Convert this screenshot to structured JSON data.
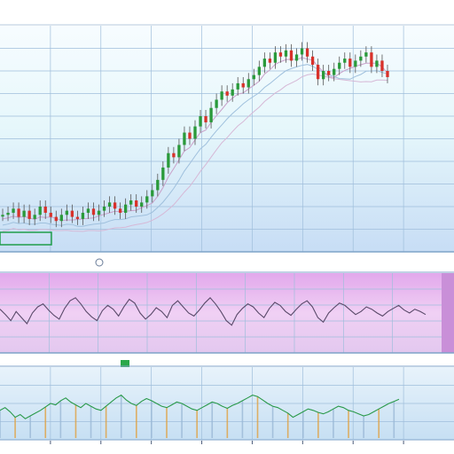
{
  "window": {
    "title": "",
    "colors": {
      "background": "#ffffff",
      "price_panel_top": "#f4fbff",
      "price_panel_bottom": "#c9e0f6",
      "oscillator_panel": "#e8b9f0",
      "volume_panel": "#cfe5f6",
      "grid": "#9fbedb",
      "candle_up": "#2a9a3a",
      "candle_down": "#d8312a",
      "oscillator_line": "#5a4a6a",
      "badge_green": "#1f9d4a"
    }
  },
  "chart_data": [
    {
      "type": "line",
      "x": [
        0,
        1,
        2,
        3,
        4,
        5,
        6,
        7,
        8,
        9,
        10,
        11,
        12,
        13,
        14,
        15,
        16,
        17,
        18,
        19,
        20,
        21,
        22,
        23,
        24,
        25,
        26,
        27,
        28,
        29,
        30,
        31,
        32,
        33,
        34,
        35,
        36,
        37,
        38,
        39,
        40,
        41,
        42,
        43,
        44,
        45,
        46,
        47,
        48,
        49,
        50,
        51,
        52,
        53,
        54,
        55,
        56,
        57,
        58,
        59,
        60,
        61,
        62,
        63,
        64,
        65,
        66,
        67,
        68,
        69,
        70,
        71,
        72
      ],
      "series": [
        {
          "values": [
            18,
            19,
            21,
            17,
            20,
            16,
            18,
            22,
            19,
            17,
            15,
            18,
            20,
            17,
            16,
            19,
            21,
            18,
            20,
            22,
            24,
            21,
            19,
            23,
            25,
            22,
            24,
            27,
            30,
            35,
            41,
            48,
            46,
            52,
            58,
            55,
            61,
            66,
            63,
            70,
            74,
            78,
            76,
            79,
            82,
            80,
            84,
            86,
            90,
            94,
            92,
            97,
            95,
            98,
            93,
            96,
            99,
            95,
            91,
            84,
            88,
            86,
            89,
            92,
            94,
            90,
            93,
            95,
            97,
            90,
            93,
            88,
            85
          ]
        }
      ],
      "ylim": [
        0,
        110
      ],
      "grid": true
    },
    {
      "type": "line",
      "x": [
        0,
        1,
        2,
        3,
        4,
        5,
        6,
        7,
        8,
        9,
        10,
        11,
        12,
        13,
        14,
        15,
        16,
        17,
        18,
        19,
        20,
        21,
        22,
        23,
        24,
        25,
        26,
        27,
        28,
        29,
        30,
        31,
        32,
        33,
        34,
        35,
        36,
        37,
        38,
        39,
        40,
        41,
        42,
        43,
        44,
        45,
        46,
        47,
        48,
        49,
        50,
        51,
        52,
        53,
        54,
        55,
        56,
        57,
        58,
        59,
        60,
        61,
        62,
        63,
        64,
        65,
        66,
        67,
        68,
        69,
        70,
        71,
        72,
        73,
        74,
        75,
        76,
        77,
        78,
        79
      ],
      "series": [
        {
          "values": [
            55,
            48,
            40,
            52,
            44,
            36,
            50,
            58,
            62,
            54,
            47,
            42,
            56,
            66,
            70,
            62,
            52,
            45,
            40,
            53,
            60,
            55,
            46,
            58,
            68,
            63,
            50,
            42,
            48,
            57,
            52,
            44,
            60,
            66,
            58,
            50,
            46,
            54,
            63,
            70,
            62,
            52,
            40,
            34,
            48,
            56,
            62,
            58,
            50,
            44,
            56,
            64,
            60,
            52,
            47,
            55,
            62,
            66,
            58,
            44,
            38,
            50,
            57,
            63,
            60,
            54,
            48,
            52,
            58,
            55,
            50,
            46,
            52,
            56,
            60,
            54,
            50,
            55,
            52,
            48
          ]
        }
      ],
      "ylim": [
        0,
        100
      ],
      "grid": true
    },
    {
      "type": "line",
      "x": [
        0,
        1,
        2,
        3,
        4,
        5,
        6,
        7,
        8,
        9,
        10,
        11,
        12,
        13,
        14,
        15,
        16,
        17,
        18,
        19,
        20,
        21,
        22,
        23,
        24,
        25,
        26,
        27,
        28,
        29,
        30,
        31,
        32,
        33,
        34,
        35,
        36,
        37,
        38,
        39,
        40,
        41,
        42,
        43,
        44,
        45,
        46,
        47,
        48,
        49,
        50,
        51,
        52,
        53,
        54,
        55,
        56,
        57,
        58,
        59,
        60,
        61,
        62,
        63,
        64,
        65,
        66,
        67,
        68,
        69,
        70,
        71,
        72,
        73,
        74,
        75,
        76,
        77,
        78,
        79
      ],
      "series": [
        {
          "values": [
            40,
            44,
            38,
            30,
            34,
            28,
            32,
            36,
            40,
            45,
            50,
            48,
            54,
            58,
            52,
            48,
            44,
            50,
            46,
            42,
            40,
            46,
            52,
            58,
            62,
            55,
            50,
            47,
            53,
            57,
            54,
            50,
            46,
            44,
            48,
            52,
            50,
            46,
            42,
            40,
            44,
            48,
            52,
            50,
            46,
            43,
            47,
            50,
            54,
            58,
            62,
            60,
            55,
            50,
            46,
            44,
            40,
            36,
            30,
            34,
            38,
            42,
            40,
            37,
            35,
            38,
            42,
            46,
            44,
            40,
            38,
            35,
            32,
            34,
            38,
            42,
            46,
            50,
            53,
            56
          ]
        }
      ],
      "ylim": [
        0,
        100
      ],
      "grid": true
    }
  ]
}
